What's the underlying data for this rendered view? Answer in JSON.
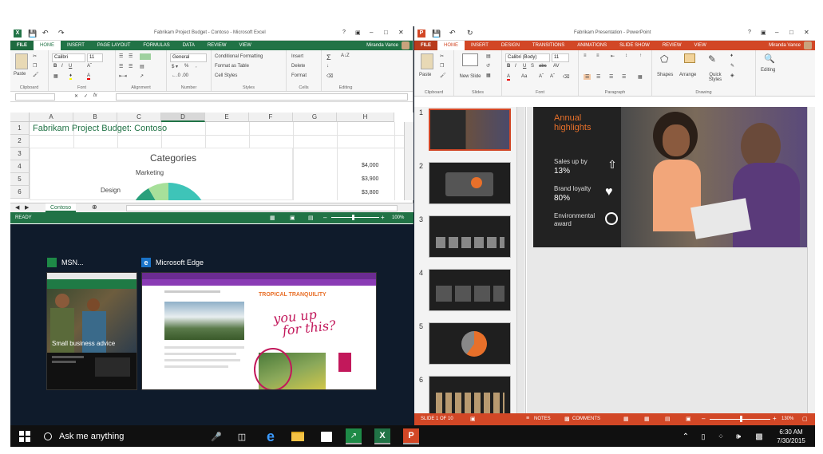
{
  "excel": {
    "title": "Fabrikam Project Budget - Contoso - Microsoft Excel",
    "user": "Miranda Vance",
    "tabs": [
      "FILE",
      "HOME",
      "INSERT",
      "PAGE LAYOUT",
      "FORMULAS",
      "DATA",
      "REVIEW",
      "VIEW"
    ],
    "ribbon": {
      "paste": "Paste",
      "font_name": "Calibri",
      "font_size": "11",
      "number_format": "General",
      "conditional": "Conditional Formatting",
      "format_table": "Format as Table",
      "cell_styles": "Cell Styles",
      "insert": "Insert",
      "delete": "Delete",
      "format": "Format",
      "groups": [
        "Clipboard",
        "Font",
        "Alignment",
        "Number",
        "Styles",
        "Cells",
        "Editing"
      ]
    },
    "formula_bar": {
      "fx": "fx"
    },
    "columns": [
      "A",
      "B",
      "C",
      "D",
      "E",
      "F",
      "G",
      "H"
    ],
    "rows": [
      "1",
      "2",
      "3",
      "4",
      "5",
      "6"
    ],
    "cell_title": "Fabrikam Project Budget: Contoso",
    "chart": {
      "title": "Categories",
      "label_marketing": "Marketing",
      "label_design": "Design"
    },
    "h_values": [
      "$4,000",
      "$3,900",
      "$3,800"
    ],
    "sheet_tab": "Contoso",
    "status": "READY",
    "zoom": "100%"
  },
  "taskview": {
    "msn_label": "MSN...",
    "edge_label": "Microsoft Edge",
    "msn_caption": "Small business advice",
    "edge_heading": "TROPICAL TRANQUILITY",
    "edge_handwriting_1": "you up",
    "edge_handwriting_2": "for this?"
  },
  "ppt": {
    "title": "Fabrikam Presentation - PowerPoint",
    "user": "Miranda Vance",
    "tabs": [
      "FILE",
      "HOME",
      "INSERT",
      "DESIGN",
      "TRANSITIONS",
      "ANIMATIONS",
      "SLIDE SHOW",
      "REVIEW",
      "VIEW"
    ],
    "ribbon": {
      "paste": "Paste",
      "new_slide": "New Slide",
      "font_name": "Calibri (Body)",
      "font_size": "11",
      "shapes": "Shapes",
      "arrange": "Arrange",
      "quick_styles": "Quick Styles",
      "editing": "Editing",
      "groups": [
        "Clipboard",
        "Slides",
        "Font",
        "Paragraph",
        "Drawing"
      ]
    },
    "slide_numbers": [
      "1",
      "2",
      "3",
      "4",
      "5",
      "6"
    ],
    "slide": {
      "heading_1": "Annual",
      "heading_2": "highlights",
      "stat1_label": "Sales up by",
      "stat1_value": "13%",
      "stat2_label": "Brand loyalty",
      "stat2_value": "80%",
      "stat3_label_1": "Environmental",
      "stat3_label_2": "award"
    },
    "status": {
      "slide_of": "SLIDE 1 OF 10",
      "notes": "NOTES",
      "comments": "COMMENTS",
      "zoom": "130%"
    }
  },
  "taskbar": {
    "search": "Ask me anything",
    "time": "6:30 AM",
    "date": "7/30/2015"
  },
  "colors": {
    "excel_green": "#217346",
    "ppt_orange": "#d24726",
    "taskbar": "#101010",
    "slide_orange": "#e8702a"
  }
}
